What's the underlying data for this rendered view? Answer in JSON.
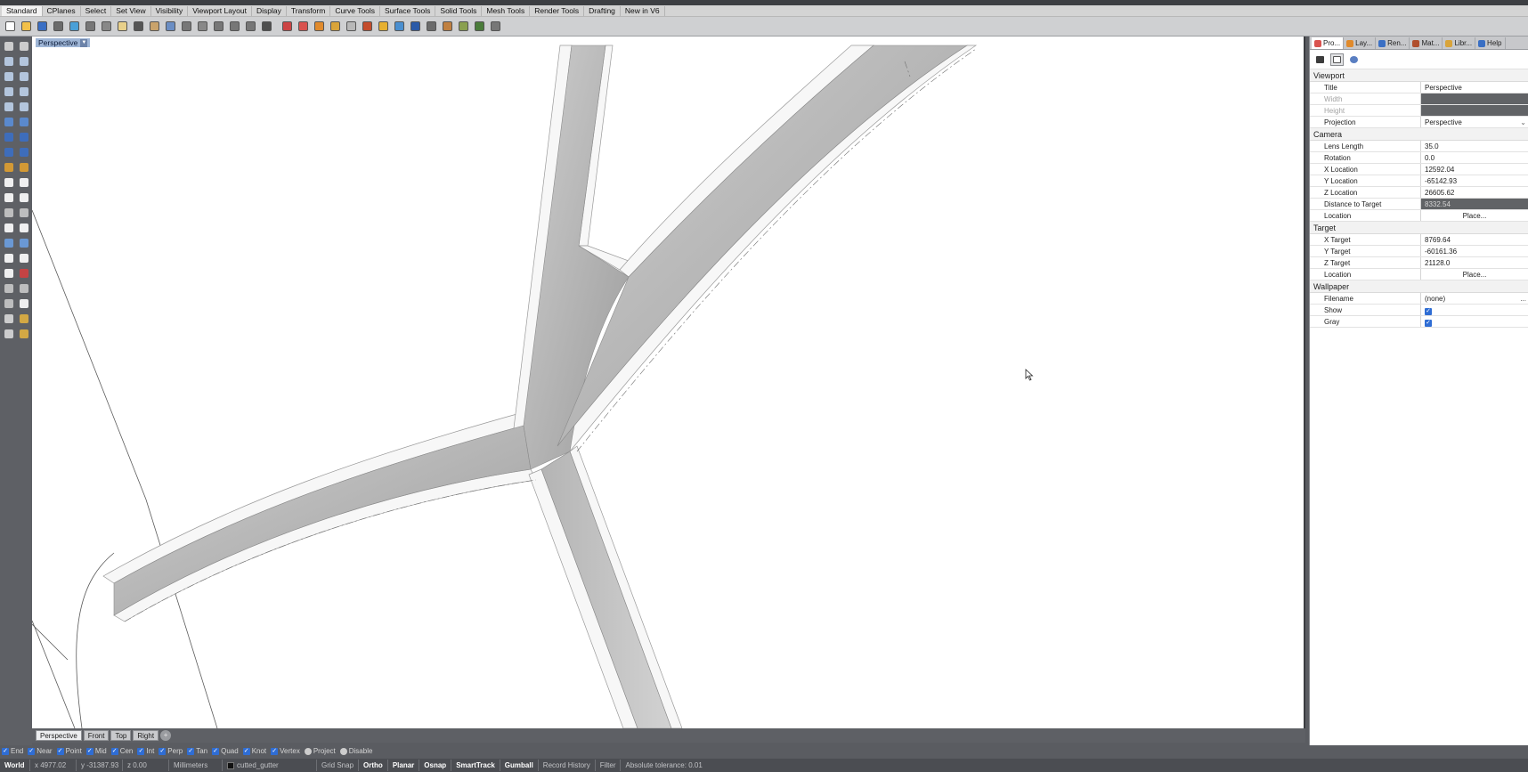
{
  "toolbar_tabs": [
    "Standard",
    "CPlanes",
    "Select",
    "Set View",
    "Visibility",
    "Viewport Layout",
    "Display",
    "Transform",
    "Curve Tools",
    "Surface Tools",
    "Solid Tools",
    "Mesh Tools",
    "Render Tools",
    "Drafting",
    "New in V6"
  ],
  "viewport": {
    "title": "Perspective",
    "tabs": [
      "Perspective",
      "Front",
      "Top",
      "Right"
    ],
    "add_tab_symbol": "+"
  },
  "osnaps": [
    {
      "label": "End",
      "checked": true
    },
    {
      "label": "Near",
      "checked": true
    },
    {
      "label": "Point",
      "checked": true
    },
    {
      "label": "Mid",
      "checked": true
    },
    {
      "label": "Cen",
      "checked": true
    },
    {
      "label": "Int",
      "checked": true
    },
    {
      "label": "Perp",
      "checked": true
    },
    {
      "label": "Tan",
      "checked": true
    },
    {
      "label": "Quad",
      "checked": true
    },
    {
      "label": "Knot",
      "checked": true
    },
    {
      "label": "Vertex",
      "checked": true
    },
    {
      "label": "Project",
      "checked": false
    },
    {
      "label": "Disable",
      "checked": false
    }
  ],
  "statusbar": {
    "cplane": "World",
    "x": "x 4977.02",
    "y": "y -31387.93",
    "z": "z 0.00",
    "units": "Millimeters",
    "layer": "cutted_gutter",
    "toggles": [
      {
        "label": "Grid Snap",
        "on": false
      },
      {
        "label": "Ortho",
        "on": true
      },
      {
        "label": "Planar",
        "on": true
      },
      {
        "label": "Osnap",
        "on": true
      },
      {
        "label": "SmartTrack",
        "on": true
      },
      {
        "label": "Gumball",
        "on": true
      },
      {
        "label": "Record History",
        "on": false
      },
      {
        "label": "Filter",
        "on": false
      }
    ],
    "tolerance": "Absolute tolerance: 0.01"
  },
  "panel": {
    "tabs": [
      {
        "label": "Pro...",
        "icon": "properties-icon",
        "color": "#d9534f"
      },
      {
        "label": "Lay...",
        "icon": "layers-icon",
        "color": "#e08a2c"
      },
      {
        "label": "Ren...",
        "icon": "render-icon",
        "color": "#3a6fc4"
      },
      {
        "label": "Mat...",
        "icon": "material-icon",
        "color": "#b04f2e"
      },
      {
        "label": "Libr...",
        "icon": "library-icon",
        "color": "#d9a43a"
      },
      {
        "label": "Help",
        "icon": "help-icon",
        "color": "#3a6fc4"
      }
    ],
    "sections": {
      "viewport": "Viewport",
      "camera": "Camera",
      "target": "Target",
      "wallpaper": "Wallpaper"
    },
    "viewport_props": {
      "title_label": "Title",
      "title_value": "Perspective",
      "width_label": "Width",
      "height_label": "Height",
      "projection_label": "Projection",
      "projection_value": "Perspective"
    },
    "camera_props": {
      "lens_label": "Lens Length",
      "lens_value": "35.0",
      "rotation_label": "Rotation",
      "rotation_value": "0.0",
      "xloc_label": "X Location",
      "xloc_value": "12592.04",
      "yloc_label": "Y Location",
      "yloc_value": "-65142.93",
      "zloc_label": "Z Location",
      "zloc_value": "26605.62",
      "dist_label": "Distance to Target",
      "dist_value": "8332.54",
      "location_label": "Location",
      "location_button": "Place..."
    },
    "target_props": {
      "xt_label": "X Target",
      "xt_value": "8769.64",
      "yt_label": "Y Target",
      "yt_value": "-60161.36",
      "zt_label": "Z Target",
      "zt_value": "21128.0",
      "location_label": "Location",
      "location_button": "Place..."
    },
    "wallpaper_props": {
      "filename_label": "Filename",
      "filename_value": "(none)",
      "filename_more": "...",
      "show_label": "Show",
      "gray_label": "Gray"
    }
  }
}
